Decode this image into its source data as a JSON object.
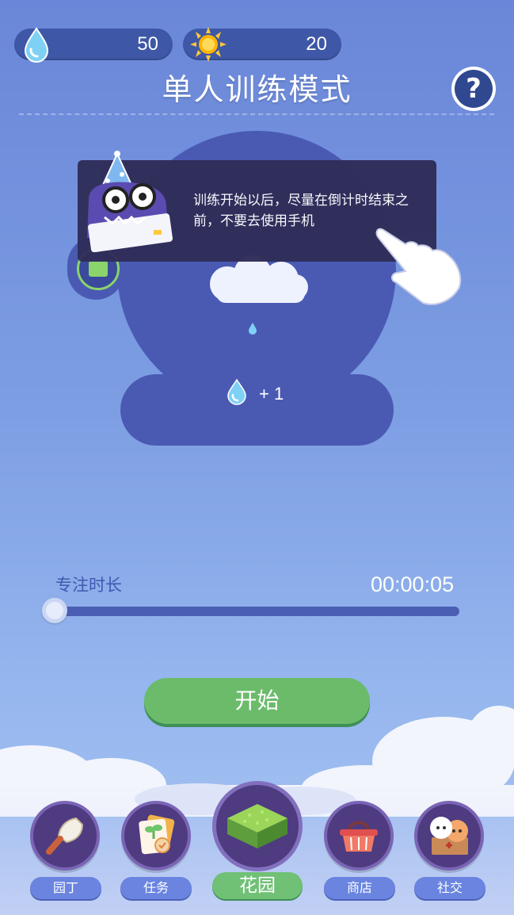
{
  "resources": {
    "water": {
      "value": "50",
      "icon": "water-drop-icon"
    },
    "sun": {
      "value": "20",
      "icon": "sun-icon"
    }
  },
  "header": {
    "title": "单人训练模式",
    "help_label": "?"
  },
  "tooltip": {
    "text": "训练开始以后，尽量在倒计时结束之前，不要去使用手机"
  },
  "reward": {
    "text": "+ 1",
    "icon": "water-drop-icon"
  },
  "focus": {
    "label": "专注时长",
    "time": "00:00:05",
    "slider_fraction": 0.0
  },
  "start_button": {
    "label": "开始"
  },
  "tabs": [
    {
      "label": "园丁",
      "icon": "trowel-icon"
    },
    {
      "label": "任务",
      "icon": "task-card-icon"
    },
    {
      "label": "花园",
      "icon": "grass-block-icon"
    },
    {
      "label": "商店",
      "icon": "basket-icon"
    },
    {
      "label": "社交",
      "icon": "friends-icon"
    }
  ],
  "colors": {
    "background": "#7d9ee3",
    "panel": "#4a5ab3",
    "start_button": "#6bbb6b",
    "tooltip": "#2f2d58"
  }
}
